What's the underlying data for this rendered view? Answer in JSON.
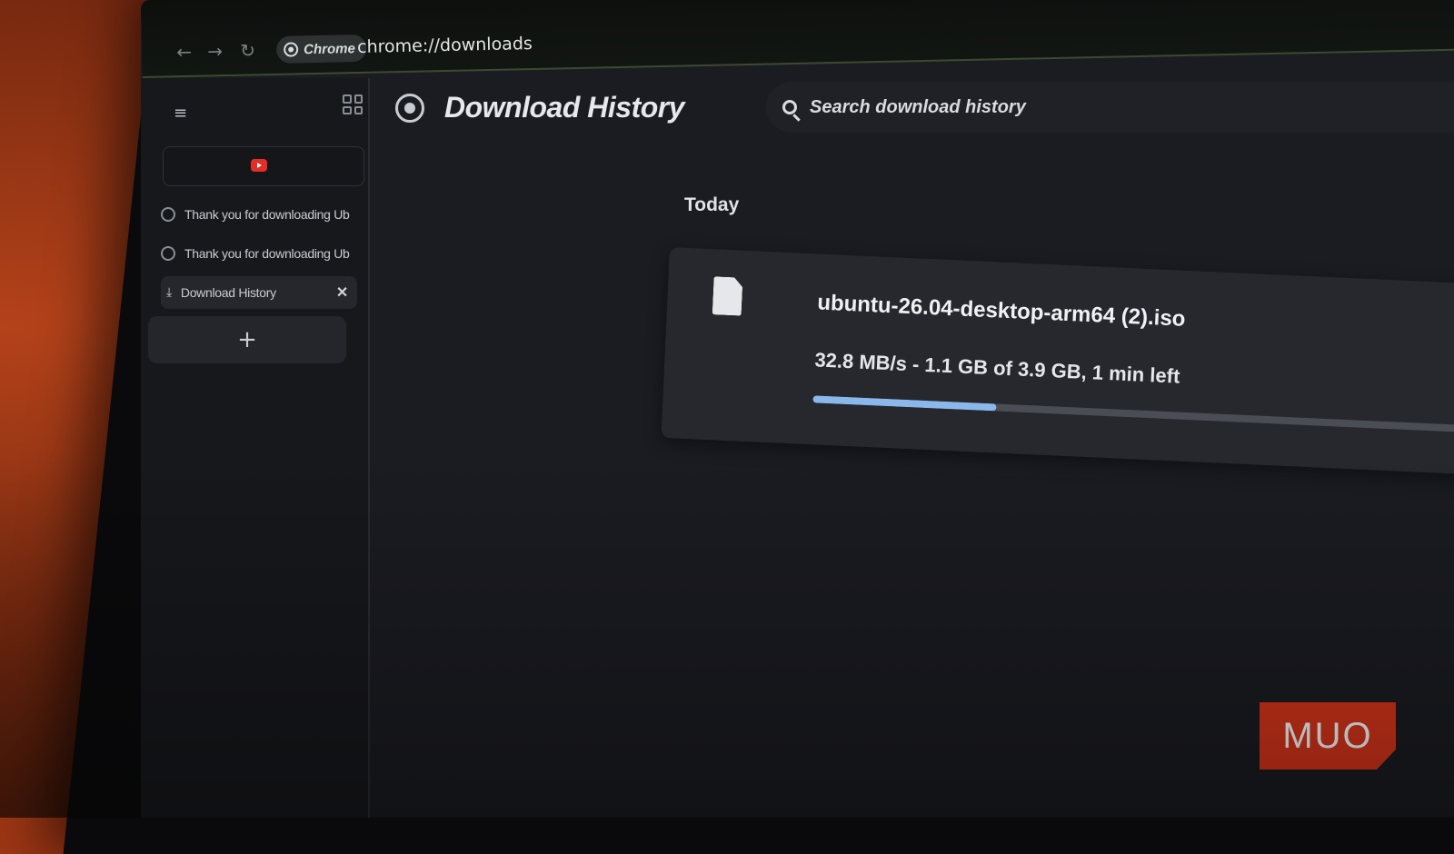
{
  "toolbar": {
    "back_icon": "arrow-left-icon",
    "forward_icon": "arrow-right-icon",
    "reload_icon": "reload-icon",
    "chip_label": "Chrome",
    "url": "chrome://downloads"
  },
  "sidebar": {
    "tabs": [
      {
        "label": "Thank you for downloading Ub"
      },
      {
        "label": "Thank you for downloading Ub"
      },
      {
        "label": "Download History"
      }
    ],
    "new_tab_label": "+"
  },
  "page": {
    "title": "Download History",
    "search_placeholder": "Search download history",
    "day_header": "Today"
  },
  "download": {
    "file_name": "ubuntu-26.04-desktop-arm64 (2).iso",
    "status": "32.8 MB/s - 1.1 GB of 3.9 GB, 1 min left",
    "progress_fraction": 0.28,
    "accent_color": "#8ab8ec"
  },
  "watermark": {
    "text": "MUO",
    "color": "#d8351a"
  }
}
